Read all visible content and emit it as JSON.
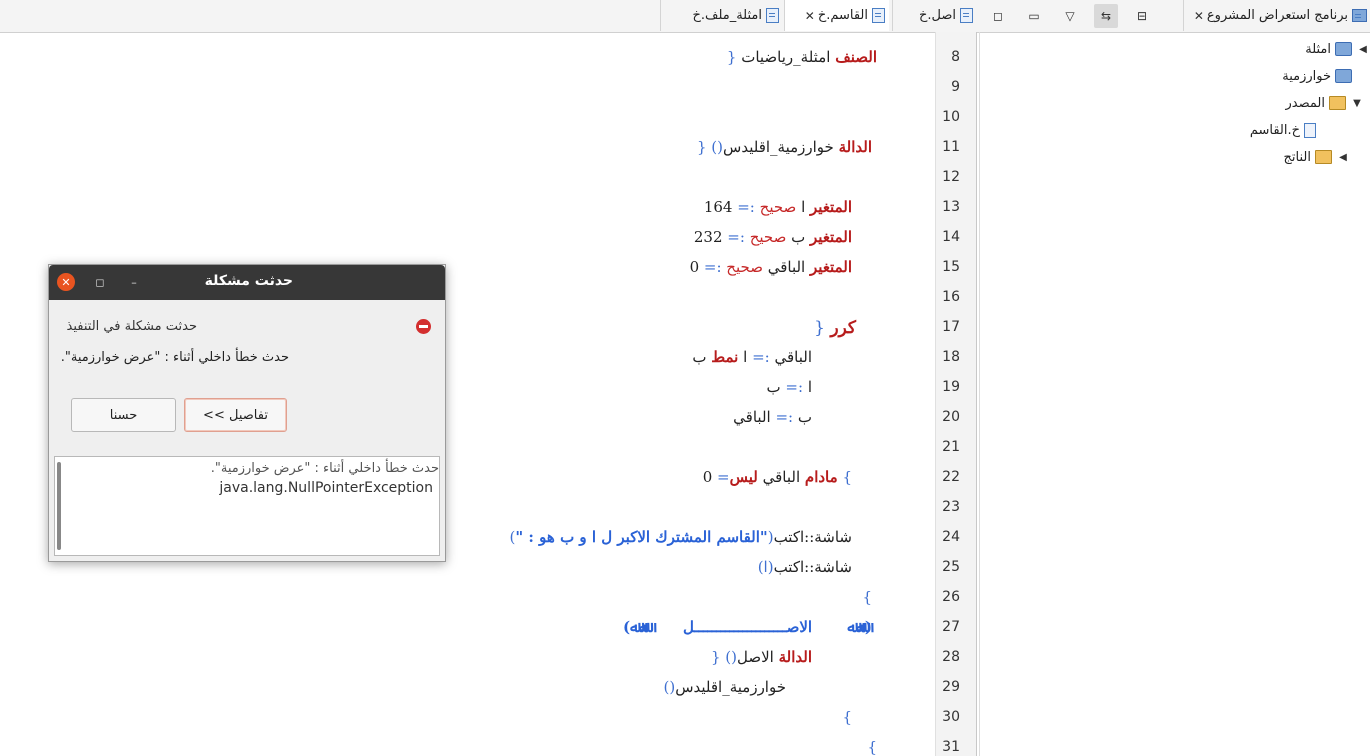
{
  "tabs": {
    "explorer": "برنامج استعراض المشروع",
    "asl": "اصل.خ",
    "qasim": "القاسم.خ",
    "amthila": "امثلة_ملف.خ"
  },
  "tree": {
    "items": [
      {
        "label": "امثلة",
        "icon": "project-icon"
      },
      {
        "label": "خوارزمية",
        "icon": "project-icon"
      },
      {
        "label": "المصدر",
        "icon": "folder-icon"
      },
      {
        "label": "خ.القاسم",
        "icon": "file-icon"
      },
      {
        "label": "الناتج",
        "icon": "folder-icon"
      }
    ]
  },
  "editor": {
    "line_numbers": [
      "8",
      "9",
      "10",
      "11",
      "12",
      "13",
      "14",
      "15",
      "16",
      "17",
      "18",
      "19",
      "20",
      "21",
      "22",
      "23",
      "24",
      "25",
      "26",
      "27",
      "28",
      "29",
      "30",
      "31"
    ],
    "l8": {
      "kw": "الصنف",
      "name": "امثلة_رياضيات",
      "brace": "{"
    },
    "l11": {
      "kw": "الدالة",
      "name": "خوارزمية_اقليدس",
      "parens": "()",
      "brace": "{"
    },
    "l13": {
      "kw": "المتغير",
      "var": "ا",
      "type": "صحيح",
      "assign": ":=",
      "val": "164"
    },
    "l14": {
      "kw": "المتغير",
      "var": "ب",
      "type": "صحيح",
      "assign": ":=",
      "val": "232"
    },
    "l15": {
      "kw": "المتغير",
      "var": "الباقي",
      "type": "صحيح",
      "assign": ":=",
      "val": "0"
    },
    "l17": {
      "kw": "كرر",
      "brace": "{"
    },
    "l18": {
      "var": "الباقي",
      "assign": ":=",
      "a": "ا",
      "kw": "نمط",
      "b": "ب"
    },
    "l19": {
      "var": "ا",
      "assign": ":=",
      "b": "ب"
    },
    "l20": {
      "var": "ب",
      "assign": ":=",
      "c": "الباقي"
    },
    "l22": {
      "brace": "}",
      "kw": "مادام",
      "var": "الباقي",
      "kw2": "ليس",
      "op": "=",
      "val": "0"
    },
    "l24": {
      "call": "شاشة::اكتب",
      "paren_open": "(",
      "str": "\"القاسم المشترك الاكبر ل ا و ب هو : \"",
      "paren_close": ")"
    },
    "l25": {
      "call": "شاشة::اكتب",
      "arg": "(ا)"
    },
    "l26": {
      "brace": "}"
    },
    "l27": {
      "left": "(ﷲﷲ",
      "mid": "الاصـــــــــــــــــــــل",
      "right": "ﷲﷲ)"
    },
    "l28": {
      "kw": "الدالة",
      "name": "الاصل",
      "parens": "()",
      "brace": "{"
    },
    "l29": {
      "call": "خوارزمية_اقليدس",
      "parens": "()"
    },
    "l30": {
      "brace": "}"
    },
    "l31": {
      "brace": "}"
    }
  },
  "dialog": {
    "title": "حدثت مشكلة",
    "message": "حدثت مشكلة في التنفيذ",
    "detail": "حدث خطأ داخلي أثناء : \"عرض خوارزمية\".",
    "details_button": "<< تفاصيل",
    "ok_button": "حسنا",
    "details_text1": "حدث خطأ داخلي أثناء : \"عرض خوارزمية\".",
    "details_text2": "java.lang.NullPointerException"
  }
}
